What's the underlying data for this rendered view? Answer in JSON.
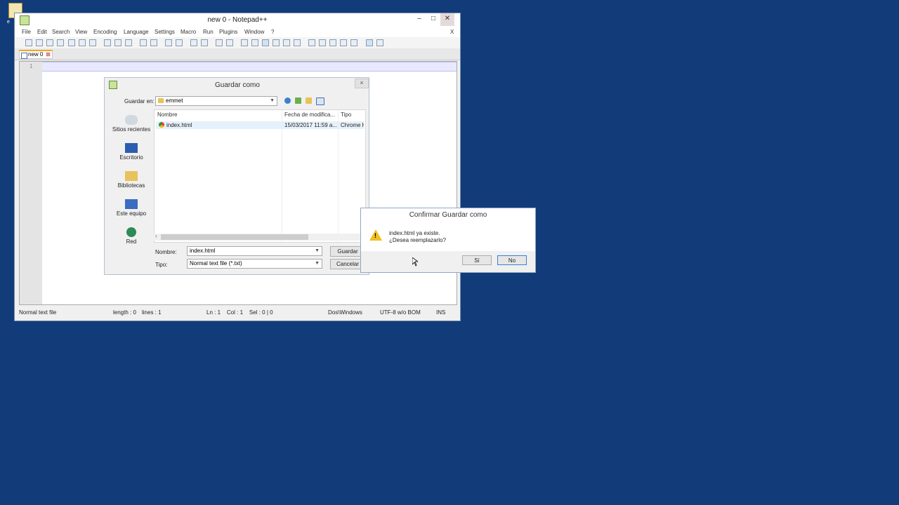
{
  "desktop": {
    "icon_label": "e"
  },
  "notepad": {
    "title": "new  0 - Notepad++",
    "menu": [
      "File",
      "Edit",
      "Search",
      "View",
      "Encoding",
      "Language",
      "Settings",
      "Macro",
      "Run",
      "Plugins",
      "Window",
      "?"
    ],
    "menu_close": "X",
    "tab_label": "new  0",
    "line_number": "1",
    "status": {
      "type": "Normal text file",
      "length": "length : 0",
      "lines": "lines : 1",
      "position": "Ln : 1    Col : 1    Sel : 0 | 0",
      "eol": "Dos\\Windows",
      "encoding": "UTF-8 w/o BOM",
      "mode": "INS"
    }
  },
  "save_dialog": {
    "title": "Guardar como",
    "save_in_label": "Guardar en:",
    "save_in_value": "emmet",
    "places": [
      "Sitios recientes",
      "Escritorio",
      "Bibliotecas",
      "Este equipo",
      "Red"
    ],
    "columns": {
      "name": "Nombre",
      "date": "Fecha de modifica...",
      "type": "Tipo"
    },
    "files": [
      {
        "name": "index.html",
        "date": "15/03/2017 11:59 a...",
        "type": "Chrome H"
      }
    ],
    "name_label": "Nombre:",
    "name_value": "index.html",
    "type_label": "Tipo:",
    "type_value": "Normal text file (*.txt)",
    "save_button": "Guardar",
    "cancel_button": "Cancelar",
    "close": "×"
  },
  "confirm_dialog": {
    "title": "Confirmar Guardar como",
    "line1": "index.html ya existe.",
    "line2": "¿Desea reemplazarlo?",
    "yes_button": "Sí",
    "no_button": "No"
  },
  "colors": {
    "desktop": "#123b7a",
    "accent": "#3c7fd1",
    "warning": "#f0c020"
  }
}
